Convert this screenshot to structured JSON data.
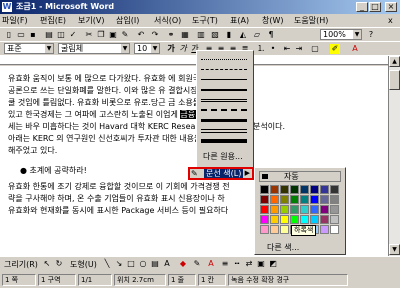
{
  "window": {
    "title": "조금1 - Microsoft Word",
    "app_icon": "W",
    "min_icon": "minimize-icon",
    "max_icon": "maximize-icon",
    "close_icon": "close-icon"
  },
  "menubar": {
    "items": [
      "파일(F)",
      "편집(E)",
      "보기(V)",
      "삽입(I)",
      "서식(O)",
      "도구(T)",
      "표(A)",
      "창(W)",
      "도움말(H)"
    ],
    "close_glyph": "x"
  },
  "toolbar": {
    "style_value": "표준",
    "font_value": "굴림체",
    "size_value": "10",
    "zoom_value": "100%"
  },
  "document": {
    "lines": [
      "유효화 움직이 보통 에 많으로 다가왔다. 유효화           에 회원국들이 내년부터",
      "공론으로 쓰는 단일화폐를 말한다. 이와 많은 유           결합시장에 이미는 파장은",
      "쿨 것임에 틀림없다. 유효화 비롯으로 유로.당근           금 소용돌이에 휘말릴 수",
      "있고 한국경제는 그 여파에 고스란히 노출된           이업게",
      "세는 바우 미흡하다는 것이 Havard 대학 KERC           Research Center) 의 분석이다.",
      "아래는 KERC 의 연구원인 신선호씨가 투자관           대한 내용을 다룬과 정이",
      "해주었고 있다."
    ],
    "highlight_text": "금융기관의",
    "bullet": "●",
    "bullet_heading": "초계에 공략하라!",
    "lines2": [
      "유효화 한통에 조기 강제로 융합할 것이므로 이 기회에 가격경쟁           전",
      "략을 구사해야 하며, 온 수출 기업들이 유효화 표시 신용장이나           하",
      "유효화와 현재화를 동시에 표시한 Package 서비스 등이 필요하다"
    ]
  },
  "border_dropdown": {
    "more_label": "다른 원용..."
  },
  "line_color_button": {
    "label": "문선 색(L)",
    "icon": "pen-icon"
  },
  "color_palette": {
    "automatic_label": "자동",
    "tooltip": "하록색",
    "more_label": "다른 색...",
    "colors": [
      "#000000",
      "#993300",
      "#333300",
      "#003300",
      "#003366",
      "#000080",
      "#333399",
      "#333333",
      "#800000",
      "#ff6600",
      "#808000",
      "#008000",
      "#008080",
      "#0000ff",
      "#666699",
      "#808080",
      "#ff0000",
      "#ff9900",
      "#99cc00",
      "#339966",
      "#33cccc",
      "#3366ff",
      "#800080",
      "#969696",
      "#ff00ff",
      "#ffcc00",
      "#ffff00",
      "#00ff00",
      "#00ffff",
      "#00ccff",
      "#993366",
      "#c0c0c0",
      "#ff99cc",
      "#ffcc99",
      "#ffff99",
      "#ccffcc",
      "#ccffff",
      "#99ccff",
      "#cc99ff",
      "#ffffff"
    ]
  },
  "drawbar": {
    "draw_label": "그리기(R)",
    "autoshape_label": "도형(U)"
  },
  "statusbar": {
    "page": "1 쪽",
    "section": "1 구역",
    "pages": "1/1",
    "position": "위치 2.7cm",
    "line": "1 줄",
    "column": "1 칸",
    "modes": "녹음  수정  확장  경구"
  }
}
